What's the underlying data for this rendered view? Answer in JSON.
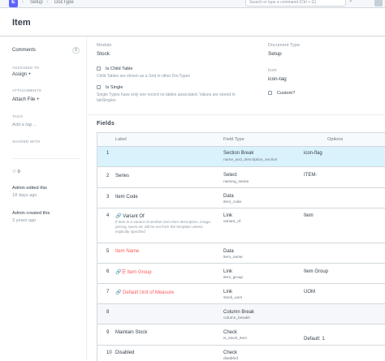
{
  "navbar": {
    "brand_letter": "E",
    "breadcrumbs": [
      "Setup",
      "DocType"
    ],
    "search_placeholder": "Search or type a command (Ctrl + G)"
  },
  "page": {
    "title": "Item"
  },
  "sidebar": {
    "comments_label": "Comments",
    "comments_count": "0",
    "assigned_to_label": "ASSIGNED TO",
    "assign_action": "Assign +",
    "attachments_label": "ATTACHMENTS",
    "attach_action": "Attach File +",
    "tags_label": "TAGS",
    "add_tag": "Add a tag ...",
    "shared_label": "SHARED WITH",
    "likes": "0",
    "edited_by": "Admin edited this",
    "edited_when": "18 days ago",
    "created_by": "Admin created this",
    "created_when": "3 years ago"
  },
  "form": {
    "module_label": "Module",
    "module_value": "Stock",
    "doctype_label": "Document Type",
    "doctype_value": "Setup",
    "icon_label": "Icon",
    "icon_value": "icon-tag",
    "is_child_label": "Is Child Table",
    "is_child_help": "Child Tables are shown as a Grid in other DocTypes",
    "is_single_label": "Is Single",
    "is_single_help": "Single Types have only one record no tables associated. Values are stored in tabSingles",
    "custom_label": "Custom?",
    "fields_title": "Fields"
  },
  "grid": {
    "headers": {
      "label": "Label",
      "type": "Field Type",
      "options": "Options"
    },
    "rows": [
      {
        "no": "1",
        "label": "",
        "type": "Section Break",
        "name": "name_and_description_section",
        "options": "icon-flag"
      },
      {
        "no": "2",
        "label": "Series",
        "type": "Select",
        "name": "naming_series",
        "options": "ITEM-"
      },
      {
        "no": "3",
        "label": "Item Code",
        "type": "Data",
        "name": "item_code",
        "options": ""
      },
      {
        "no": "4",
        "label": "Variant Of",
        "desc": "If item is a variant of another item then description, image, pricing, taxes etc will be set from the template unless explicitly specified",
        "type": "Link",
        "name": "variant_of",
        "options": "Item"
      },
      {
        "no": "5",
        "label": "Item Name",
        "type": "Data",
        "name": "item_name",
        "options": ""
      },
      {
        "no": "6",
        "label": "Item Group",
        "type": "Link",
        "name": "item_group",
        "options": "Item Group"
      },
      {
        "no": "7",
        "label": "Default Unit of Measure",
        "type": "Link",
        "name": "stock_uom",
        "options": "UOM"
      },
      {
        "no": "8",
        "label": "",
        "type": "Column Break",
        "name": "column_break0",
        "options": ""
      },
      {
        "no": "9",
        "label": "Maintain Stock",
        "type": "Check",
        "name": "is_stock_item",
        "options": "Default: 1"
      },
      {
        "no": "10",
        "label": "Disabled",
        "type": "Check",
        "name": "disabled",
        "options": ""
      }
    ]
  }
}
